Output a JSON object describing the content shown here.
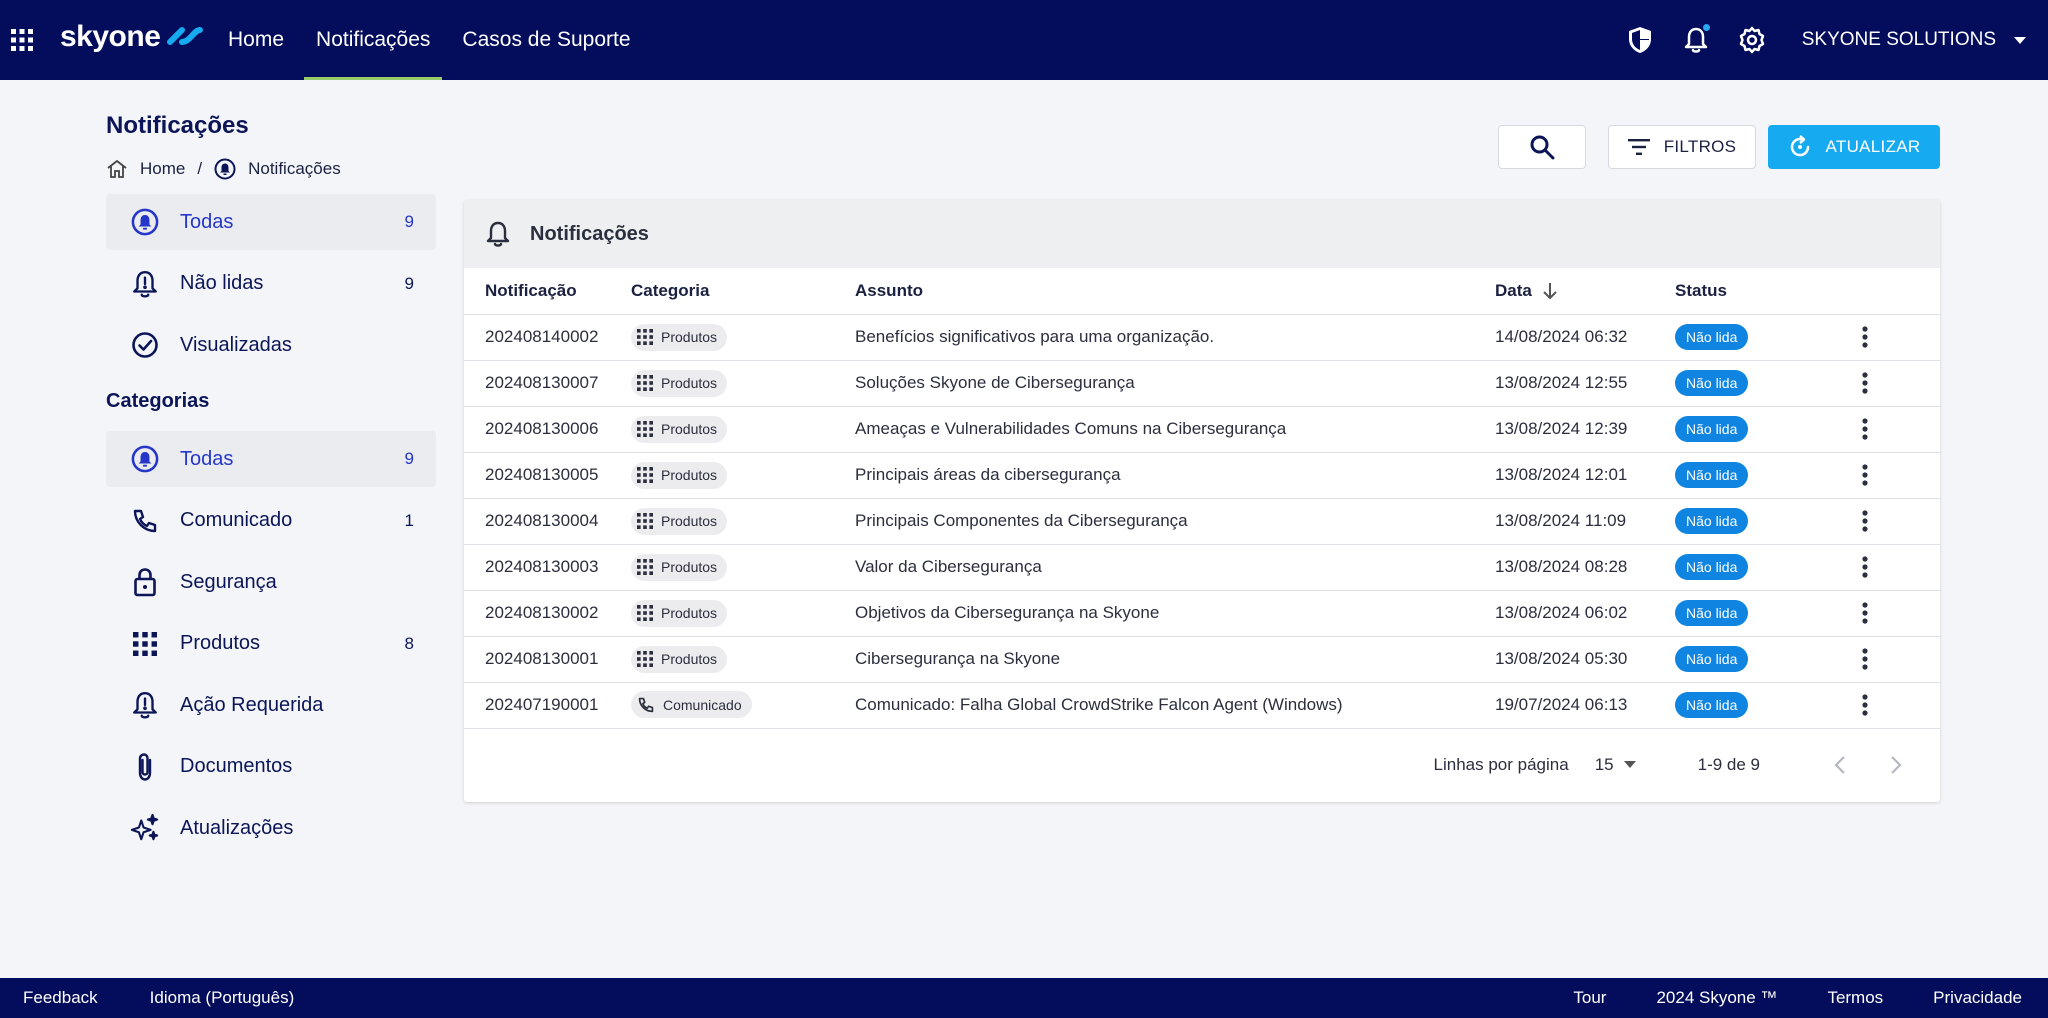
{
  "brand": {
    "name": "skyone",
    "accent": "#16aaf0",
    "navy": "#040c5c"
  },
  "nav": {
    "items": [
      {
        "label": "Home"
      },
      {
        "label": "Notificações",
        "active": true
      },
      {
        "label": "Casos de Suporte"
      }
    ]
  },
  "topbar": {
    "company": "SKYONE SOLUTIONS"
  },
  "page": {
    "title": "Notificações"
  },
  "breadcrumb": {
    "home": "Home",
    "sep": "/",
    "current": "Notificações"
  },
  "actions": {
    "filter": "FILTROS",
    "refresh": "ATUALIZAR"
  },
  "sidebar": {
    "status_items": [
      {
        "label": "Todas",
        "count": "9",
        "icon": "bell-circle-icon",
        "active": true
      },
      {
        "label": "Não lidas",
        "count": "9",
        "icon": "bell-alert-icon"
      },
      {
        "label": "Visualizadas",
        "count": "",
        "icon": "check-circle-icon"
      }
    ],
    "categories_heading": "Categorias",
    "category_items": [
      {
        "label": "Todas",
        "count": "9",
        "icon": "bell-circle-icon",
        "active": true
      },
      {
        "label": "Comunicado",
        "count": "1",
        "icon": "phone-icon"
      },
      {
        "label": "Segurança",
        "count": "",
        "icon": "lock-icon"
      },
      {
        "label": "Produtos",
        "count": "8",
        "icon": "grid-icon"
      },
      {
        "label": "Ação Requerida",
        "count": "",
        "icon": "bell-alert-icon"
      },
      {
        "label": "Documentos",
        "count": "",
        "icon": "paperclip-icon"
      },
      {
        "label": "Atualizações",
        "count": "",
        "icon": "sparkle-icon"
      }
    ]
  },
  "table": {
    "title": "Notificações",
    "columns": [
      "Notificação",
      "Categoria",
      "Assunto",
      "Data",
      "Status"
    ],
    "rows": [
      {
        "id": "202408140002",
        "category": "Produtos",
        "subject": "Benefícios significativos para uma organização.",
        "date": "14/08/2024 06:32",
        "status": "Não lida"
      },
      {
        "id": "202408130007",
        "category": "Produtos",
        "subject": "Soluções Skyone de Cibersegurança",
        "date": "13/08/2024 12:55",
        "status": "Não lida"
      },
      {
        "id": "202408130006",
        "category": "Produtos",
        "subject": "Ameaças e Vulnerabilidades Comuns na Cibersegurança",
        "date": "13/08/2024 12:39",
        "status": "Não lida"
      },
      {
        "id": "202408130005",
        "category": "Produtos",
        "subject": "Principais áreas da cibersegurança",
        "date": "13/08/2024 12:01",
        "status": "Não lida"
      },
      {
        "id": "202408130004",
        "category": "Produtos",
        "subject": "Principais Componentes da Cibersegurança",
        "date": "13/08/2024 11:09",
        "status": "Não lida"
      },
      {
        "id": "202408130003",
        "category": "Produtos",
        "subject": "Valor da Cibersegurança",
        "date": "13/08/2024 08:28",
        "status": "Não lida"
      },
      {
        "id": "202408130002",
        "category": "Produtos",
        "subject": "Objetivos da Cibersegurança na Skyone",
        "date": "13/08/2024 06:02",
        "status": "Não lida"
      },
      {
        "id": "202408130001",
        "category": "Produtos",
        "subject": "Cibersegurança na Skyone",
        "date": "13/08/2024 05:30",
        "status": "Não lida"
      },
      {
        "id": "202407190001",
        "category": "Comunicado",
        "subject": "Comunicado: Falha Global CrowdStrike Falcon Agent (Windows)",
        "date": "19/07/2024 06:13",
        "status": "Não lida"
      }
    ],
    "rows_per_page_label": "Linhas por página",
    "rows_per_page": "15",
    "range": "1-9 de 9"
  },
  "footer": {
    "feedback": "Feedback",
    "language": "Idioma (Português)",
    "tour": "Tour",
    "copyright": "2024 Skyone ™",
    "terms": "Termos",
    "privacy": "Privacidade"
  }
}
